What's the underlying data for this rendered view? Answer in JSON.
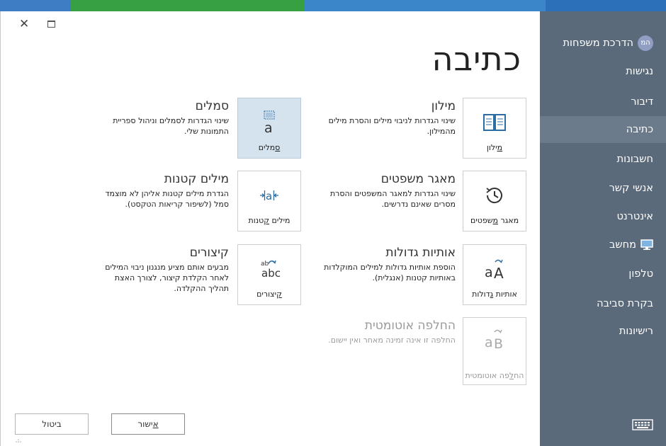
{
  "colors": {
    "sidebar_bg": "#5a6a7b",
    "sidebar_active": "#6c7b8b",
    "tile_selected": "#d5e3ef",
    "topbar": [
      "#3e7cc3",
      "#36a043",
      "#3a86c8",
      "#2b70b8"
    ]
  },
  "page": {
    "title": "כתיבה"
  },
  "tiles": {
    "dictionary": {
      "label_u": "מ",
      "label_rest": "ילון",
      "title": "מילון",
      "desc": "שינוי הגדרות לניבוי מילים והסרת מילים מהמילון."
    },
    "phrases": {
      "label_pre": "מאגר ",
      "label_u": "מ",
      "label_rest": "שפטים",
      "title": "מאגר משפטים",
      "desc": "שינוי הגדרות למאגר המשפטים והסרת מסרים שאינם נדרשים."
    },
    "capitals": {
      "label_pre": "אותיות ",
      "label_u": "ג",
      "label_rest": "דולות",
      "title": "אותיות גדולות",
      "desc": "הוספת אותיות גדולות למילים המוקלדות באותיות קטנות (אנגלית)."
    },
    "autoreplace": {
      "label_pre": "הח",
      "label_u": "ל",
      "label_rest": "פה אוטומטית",
      "title": "החלפה אוטומטית",
      "desc": "החלפה זו אינה זמינה מאחר ואין יישום."
    },
    "symbols": {
      "label_u": "ס",
      "label_rest": "מלים",
      "title": "סמלים",
      "desc": "שינוי הגדרות לסמלים וניהול ספריית התמונות שלי."
    },
    "smallwords": {
      "label_pre": "מילים ",
      "label_u": "ק",
      "label_rest": "טנות",
      "title": "מילים קטנות",
      "desc": "הגדרת מילים קטנות אליהן לא מוצמד סמל (לשיפור קריאות הטקסט)."
    },
    "shortcuts": {
      "label_u": "ק",
      "label_rest": "יצורים",
      "title": "קיצורים",
      "desc": "מבעים אותם מציע מנגנון ניבוי המילים לאחר הקלדת קיצור, לצורך האצת תהליך ההקלדה."
    }
  },
  "buttons": {
    "ok_u": "א",
    "ok_rest": "ישור",
    "cancel": "ביטול"
  },
  "sidebar": {
    "user": {
      "initials": "המ",
      "name": "הדרכת משפחות"
    },
    "items": [
      "נגישות",
      "דיבור",
      "כתיבה",
      "חשבונות",
      "אנשי קשר",
      "אינטרנט",
      "מחשב",
      "טלפון",
      "בקרת סביבה",
      "רישיונות"
    ]
  }
}
